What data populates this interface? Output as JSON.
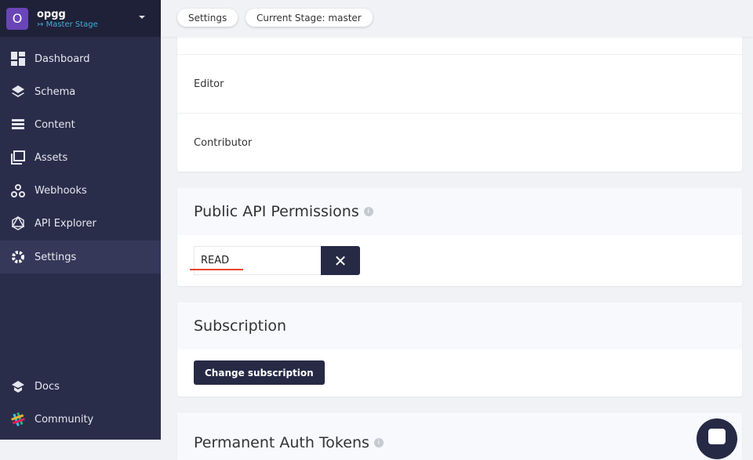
{
  "project": {
    "initial": "O",
    "name": "opgg",
    "stage": "Master Stage"
  },
  "nav": [
    {
      "label": "Dashboard"
    },
    {
      "label": "Schema"
    },
    {
      "label": "Content"
    },
    {
      "label": "Assets"
    },
    {
      "label": "Webhooks"
    },
    {
      "label": "API Explorer"
    },
    {
      "label": "Settings"
    },
    {
      "label": "Docs"
    },
    {
      "label": "Community"
    }
  ],
  "breadcrumbs": {
    "settings": "Settings",
    "stage": "Current Stage: master"
  },
  "roles": [
    "Editor",
    "Contributor"
  ],
  "public_api": {
    "title": "Public API Permissions",
    "value": "READ"
  },
  "subscription": {
    "title": "Subscription",
    "button": "Change subscription"
  },
  "tokens": {
    "title": "Permanent Auth Tokens"
  },
  "colors": {
    "accent": "#262a45",
    "underline": "#e8452c",
    "stage": "#3fb0d8"
  }
}
